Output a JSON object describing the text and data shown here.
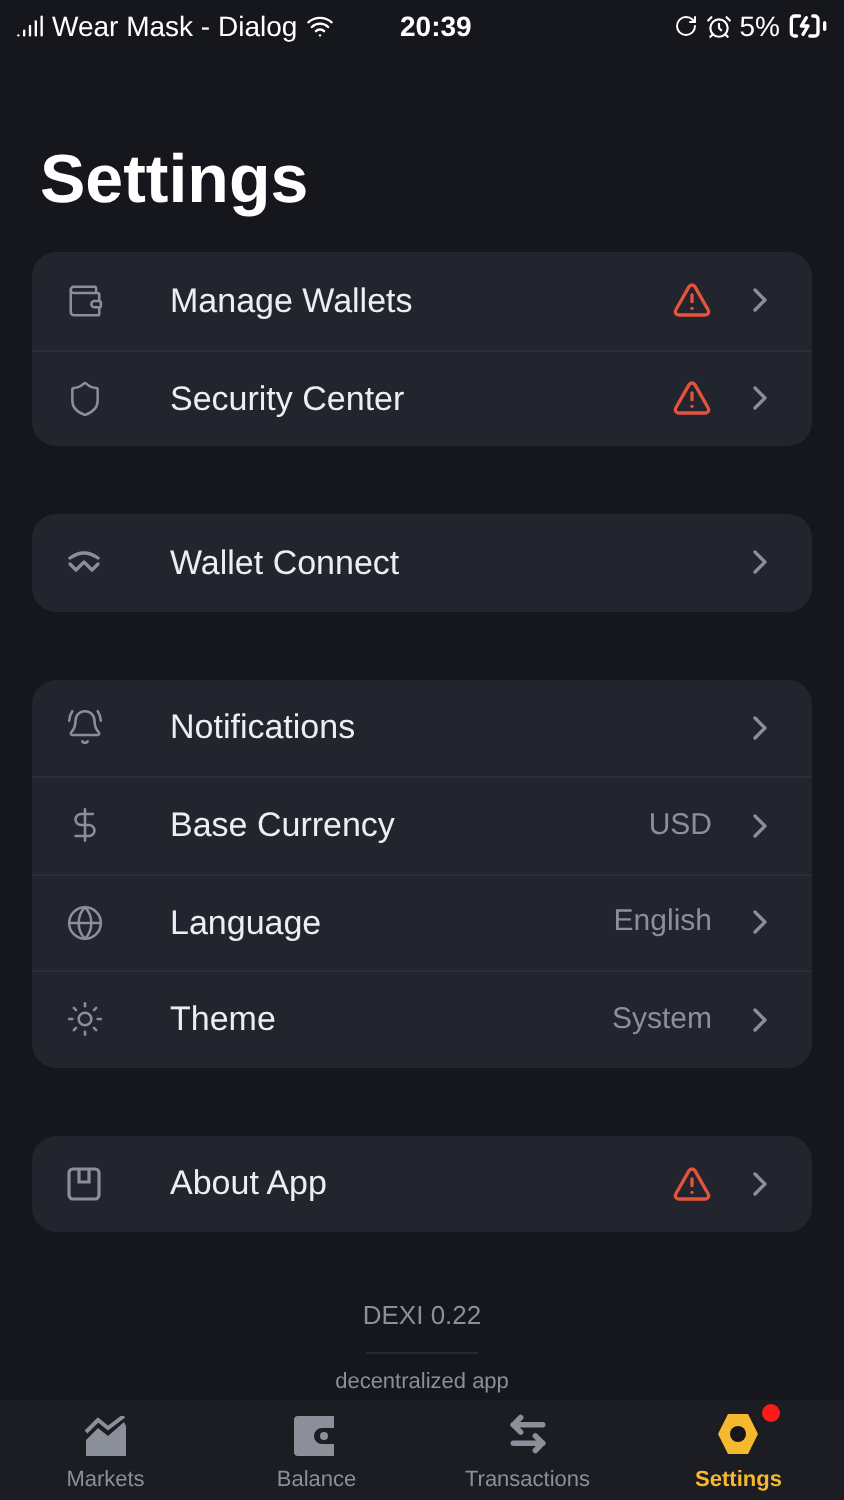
{
  "status_bar": {
    "carrier": "Wear Mask - Dialog",
    "time": "20:39",
    "battery": "5%"
  },
  "title": "Settings",
  "groups": [
    {
      "items": [
        {
          "kind": "wallet",
          "label": "Manage Wallets",
          "warning": true
        },
        {
          "kind": "shield",
          "label": "Security Center",
          "warning": true
        }
      ]
    },
    {
      "items": [
        {
          "kind": "connect",
          "label": "Wallet Connect",
          "warning": false
        }
      ]
    },
    {
      "items": [
        {
          "kind": "bell",
          "label": "Notifications",
          "warning": false
        },
        {
          "kind": "dollar",
          "label": "Base Currency",
          "value": "USD",
          "warning": false
        },
        {
          "kind": "globe",
          "label": "Language",
          "value": "English",
          "warning": false
        },
        {
          "kind": "sun",
          "label": "Theme",
          "value": "System",
          "warning": false
        }
      ]
    },
    {
      "items": [
        {
          "kind": "box",
          "label": "About App",
          "warning": true
        }
      ]
    }
  ],
  "footer": {
    "version": "DEXI 0.22",
    "tagline": "decentralized app"
  },
  "tabs": [
    {
      "kind": "chart",
      "label": "Markets",
      "selected": false,
      "badge": false
    },
    {
      "kind": "wallet",
      "label": "Balance",
      "selected": false,
      "badge": false
    },
    {
      "kind": "swap",
      "label": "Transactions",
      "selected": false,
      "badge": false
    },
    {
      "kind": "nut",
      "label": "Settings",
      "selected": true,
      "badge": true
    }
  ]
}
